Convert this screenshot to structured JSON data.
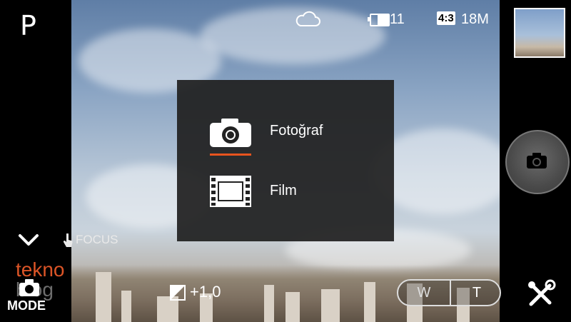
{
  "status": {
    "shooting_mode": "P",
    "weather_icon": "cloud-icon",
    "shots_remaining": "11",
    "aspect_ratio": "4:3",
    "image_size": "18M"
  },
  "mode_menu": {
    "items": [
      {
        "label": "Fotoğraf",
        "icon": "camera-icon",
        "selected": true
      },
      {
        "label": "Film",
        "icon": "film-icon",
        "selected": false
      }
    ],
    "accent_color": "#e8541e"
  },
  "controls": {
    "focus_label": "FOCUS",
    "mode_label": "MODE",
    "exposure_value": "+1,0",
    "zoom_wide": "W",
    "zoom_tele": "T"
  },
  "watermark": {
    "line1": "tekno",
    "line2": "blog"
  }
}
